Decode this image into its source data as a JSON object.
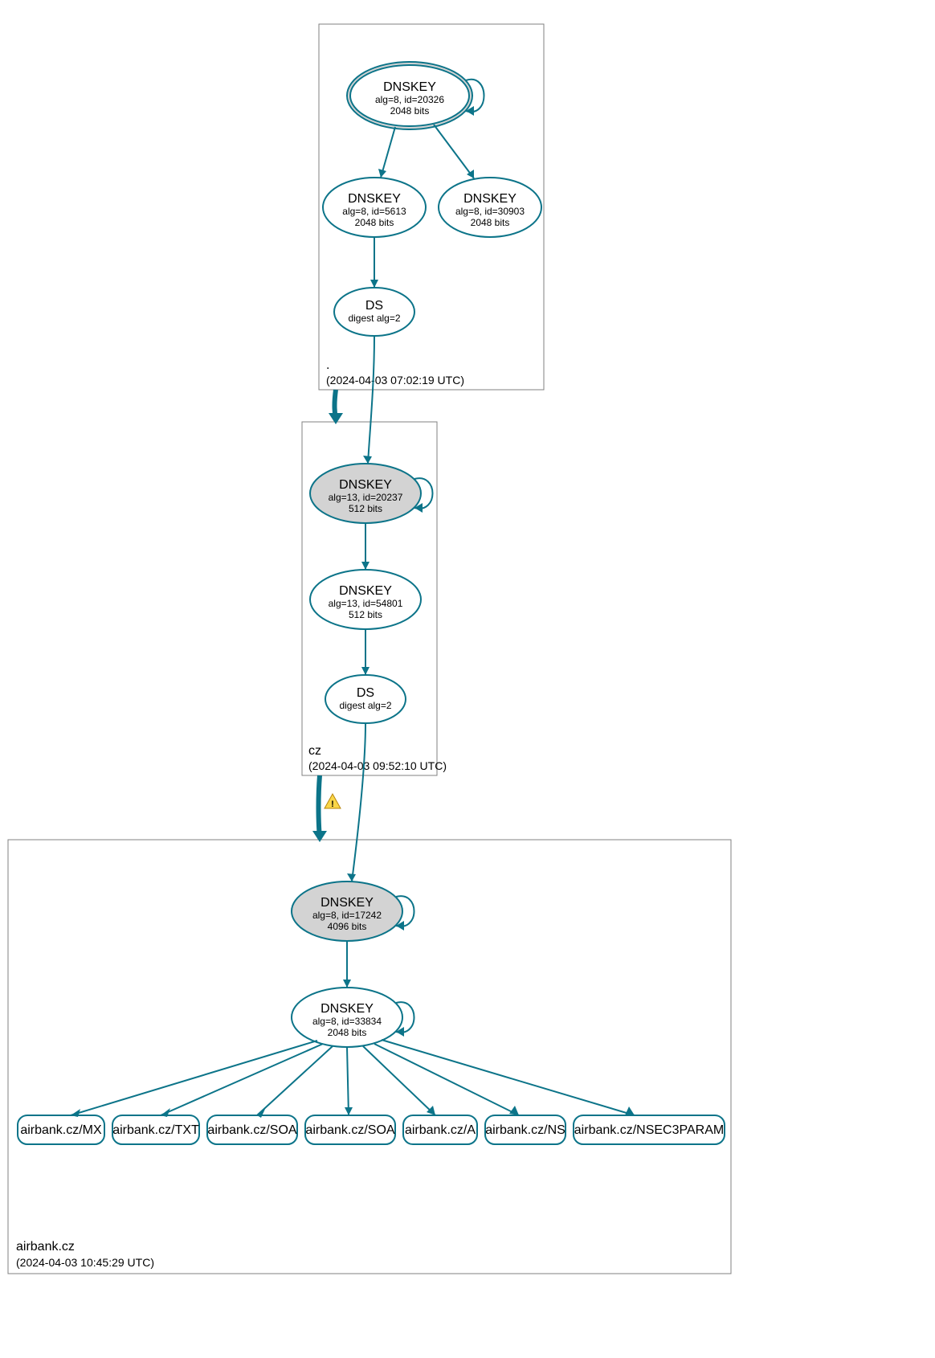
{
  "zones": {
    "root": {
      "name": ".",
      "timestamp": "(2024-04-03 07:02:19 UTC)"
    },
    "cz": {
      "name": "cz",
      "timestamp": "(2024-04-03 09:52:10 UTC)"
    },
    "airbank": {
      "name": "airbank.cz",
      "timestamp": "(2024-04-03 10:45:29 UTC)"
    }
  },
  "nodes": {
    "root_ksk": {
      "title": "DNSKEY",
      "line1": "alg=8, id=20326",
      "line2": "2048 bits"
    },
    "root_zsk1": {
      "title": "DNSKEY",
      "line1": "alg=8, id=5613",
      "line2": "2048 bits"
    },
    "root_zsk2": {
      "title": "DNSKEY",
      "line1": "alg=8, id=30903",
      "line2": "2048 bits"
    },
    "root_ds": {
      "title": "DS",
      "line1": "digest alg=2"
    },
    "cz_ksk": {
      "title": "DNSKEY",
      "line1": "alg=13, id=20237",
      "line2": "512 bits"
    },
    "cz_zsk": {
      "title": "DNSKEY",
      "line1": "alg=13, id=54801",
      "line2": "512 bits"
    },
    "cz_ds": {
      "title": "DS",
      "line1": "digest alg=2"
    },
    "ab_ksk": {
      "title": "DNSKEY",
      "line1": "alg=8, id=17242",
      "line2": "4096 bits"
    },
    "ab_zsk": {
      "title": "DNSKEY",
      "line1": "alg=8, id=33834",
      "line2": "2048 bits"
    }
  },
  "rrsets": {
    "mx": "airbank.cz/MX",
    "txt": "airbank.cz/TXT",
    "soa1": "airbank.cz/SOA",
    "soa2": "airbank.cz/SOA",
    "a": "airbank.cz/A",
    "ns": "airbank.cz/NS",
    "nsec3param": "airbank.cz/NSEC3PARAM"
  },
  "colors": {
    "stroke": "#0c7489",
    "ksk_fill": "#d3d3d3",
    "warn_fill": "#f9d649",
    "warn_stroke": "#b8860b"
  }
}
